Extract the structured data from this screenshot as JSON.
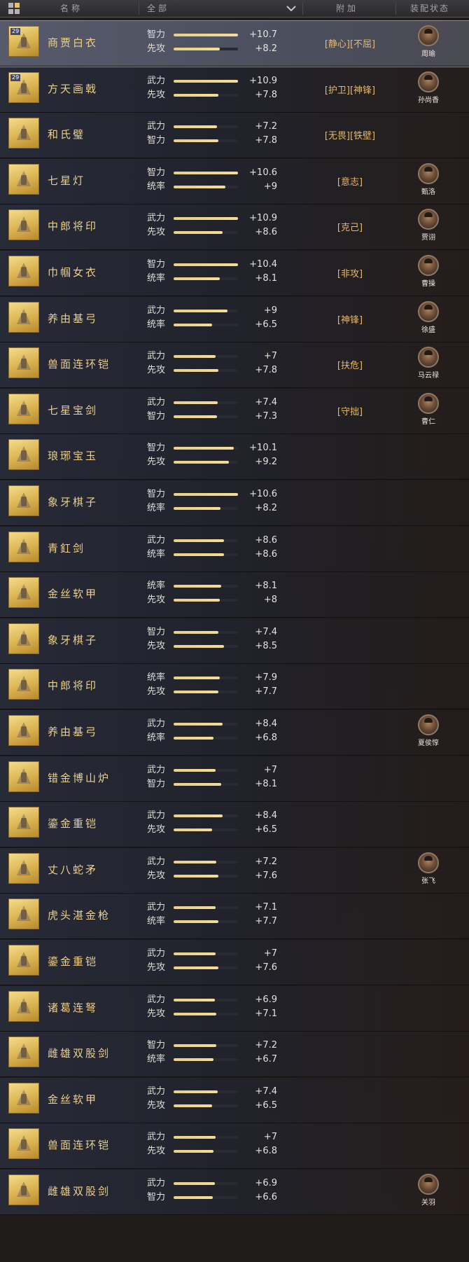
{
  "header": {
    "name_col": "名称",
    "filter_value": "全部",
    "extra_col": "附加",
    "equip_col": "装配状态"
  },
  "rows": [
    {
      "name": "商贾白衣",
      "icon": "white-robe-icon",
      "tag": "29",
      "selected": true,
      "stats": [
        {
          "label": "智力",
          "value": "+10.7",
          "pct": 1.0
        },
        {
          "label": "先攻",
          "value": "+8.2",
          "pct": 0.72
        }
      ],
      "extras": "[静心][不屈]",
      "equipped_by": "周瑜"
    },
    {
      "name": "方天画戟",
      "icon": "halberd-icon",
      "tag": "29",
      "stats": [
        {
          "label": "武力",
          "value": "+10.9",
          "pct": 1.0
        },
        {
          "label": "先攻",
          "value": "+7.8",
          "pct": 0.7
        }
      ],
      "extras": "[护卫][神锋]",
      "equipped_by": "孙尚香"
    },
    {
      "name": "和氏璧",
      "icon": "jade-disc-icon",
      "stats": [
        {
          "label": "武力",
          "value": "+7.2",
          "pct": 0.67
        },
        {
          "label": "智力",
          "value": "+7.8",
          "pct": 0.7
        }
      ],
      "extras": "[无畏][铁壁]",
      "equipped_by": ""
    },
    {
      "name": "七星灯",
      "icon": "seven-star-lamp-icon",
      "stats": [
        {
          "label": "智力",
          "value": "+10.6",
          "pct": 1.0
        },
        {
          "label": "统率",
          "value": "+9",
          "pct": 0.8
        }
      ],
      "extras": "[意志]",
      "equipped_by": "甄洛"
    },
    {
      "name": "中郎将印",
      "icon": "seal-box-icon",
      "stats": [
        {
          "label": "武力",
          "value": "+10.9",
          "pct": 1.0
        },
        {
          "label": "先攻",
          "value": "+8.6",
          "pct": 0.76
        }
      ],
      "extras": "[克己]",
      "equipped_by": "贾诩"
    },
    {
      "name": "巾帼女衣",
      "icon": "female-armor-icon",
      "stats": [
        {
          "label": "智力",
          "value": "+10.4",
          "pct": 1.0
        },
        {
          "label": "统率",
          "value": "+8.1",
          "pct": 0.72
        }
      ],
      "extras": "[非攻]",
      "equipped_by": "曹操"
    },
    {
      "name": "养由基弓",
      "icon": "bow-icon",
      "stats": [
        {
          "label": "武力",
          "value": "+9",
          "pct": 0.84
        },
        {
          "label": "统率",
          "value": "+6.5",
          "pct": 0.6
        }
      ],
      "extras": "[神锋]",
      "equipped_by": "徐盛"
    },
    {
      "name": "兽面连环铠",
      "icon": "chain-armor-icon",
      "stats": [
        {
          "label": "武力",
          "value": "+7",
          "pct": 0.65
        },
        {
          "label": "先攻",
          "value": "+7.8",
          "pct": 0.7
        }
      ],
      "extras": "[扶危]",
      "equipped_by": "马云禄"
    },
    {
      "name": "七星宝剑",
      "icon": "sword-icon",
      "stats": [
        {
          "label": "武力",
          "value": "+7.4",
          "pct": 0.68
        },
        {
          "label": "智力",
          "value": "+7.3",
          "pct": 0.67
        }
      ],
      "extras": "[守拙]",
      "equipped_by": "曹仁"
    },
    {
      "name": "琅琊宝玉",
      "icon": "jade-treasure-icon",
      "stats": [
        {
          "label": "智力",
          "value": "+10.1",
          "pct": 0.94
        },
        {
          "label": "先攻",
          "value": "+9.2",
          "pct": 0.86
        }
      ],
      "extras": "",
      "equipped_by": ""
    },
    {
      "name": "象牙棋子",
      "icon": "chess-board-icon",
      "stats": [
        {
          "label": "智力",
          "value": "+10.6",
          "pct": 1.0
        },
        {
          "label": "统率",
          "value": "+8.2",
          "pct": 0.73
        }
      ],
      "extras": "",
      "equipped_by": ""
    },
    {
      "name": "青釭剑",
      "icon": "sword-icon",
      "stats": [
        {
          "label": "武力",
          "value": "+8.6",
          "pct": 0.78
        },
        {
          "label": "统率",
          "value": "+8.6",
          "pct": 0.78
        }
      ],
      "extras": "",
      "equipped_by": ""
    },
    {
      "name": "金丝软甲",
      "icon": "golden-armor-icon",
      "stats": [
        {
          "label": "统率",
          "value": "+8.1",
          "pct": 0.74
        },
        {
          "label": "先攻",
          "value": "+8",
          "pct": 0.72
        }
      ],
      "extras": "",
      "equipped_by": ""
    },
    {
      "name": "象牙棋子",
      "icon": "chess-board-icon",
      "stats": [
        {
          "label": "智力",
          "value": "+7.4",
          "pct": 0.7
        },
        {
          "label": "先攻",
          "value": "+8.5",
          "pct": 0.78
        }
      ],
      "extras": "",
      "equipped_by": ""
    },
    {
      "name": "中郎将印",
      "icon": "seal-box-icon",
      "stats": [
        {
          "label": "统率",
          "value": "+7.9",
          "pct": 0.72
        },
        {
          "label": "先攻",
          "value": "+7.7",
          "pct": 0.7
        }
      ],
      "extras": "",
      "equipped_by": ""
    },
    {
      "name": "养由基弓",
      "icon": "bow-icon",
      "stats": [
        {
          "label": "武力",
          "value": "+8.4",
          "pct": 0.76
        },
        {
          "label": "统率",
          "value": "+6.8",
          "pct": 0.62
        }
      ],
      "extras": "",
      "equipped_by": "夏侯惇"
    },
    {
      "name": "错金博山炉",
      "icon": "incense-burner-icon",
      "stats": [
        {
          "label": "武力",
          "value": "+7",
          "pct": 0.65
        },
        {
          "label": "智力",
          "value": "+8.1",
          "pct": 0.74
        }
      ],
      "extras": "",
      "equipped_by": ""
    },
    {
      "name": "鎏金重铠",
      "icon": "heavy-armor-icon",
      "stats": [
        {
          "label": "武力",
          "value": "+8.4",
          "pct": 0.76
        },
        {
          "label": "先攻",
          "value": "+6.5",
          "pct": 0.6
        }
      ],
      "extras": "",
      "equipped_by": ""
    },
    {
      "name": "丈八蛇矛",
      "icon": "serpent-spear-icon",
      "stats": [
        {
          "label": "武力",
          "value": "+7.2",
          "pct": 0.66
        },
        {
          "label": "先攻",
          "value": "+7.6",
          "pct": 0.7
        }
      ],
      "extras": "",
      "equipped_by": "张飞"
    },
    {
      "name": "虎头湛金枪",
      "icon": "spear-icon",
      "stats": [
        {
          "label": "武力",
          "value": "+7.1",
          "pct": 0.65
        },
        {
          "label": "统率",
          "value": "+7.7",
          "pct": 0.7
        }
      ],
      "extras": "",
      "equipped_by": ""
    },
    {
      "name": "鎏金重铠",
      "icon": "heavy-armor-icon",
      "stats": [
        {
          "label": "武力",
          "value": "+7",
          "pct": 0.65
        },
        {
          "label": "先攻",
          "value": "+7.6",
          "pct": 0.7
        }
      ],
      "extras": "",
      "equipped_by": ""
    },
    {
      "name": "诸葛连弩",
      "icon": "crossbow-icon",
      "stats": [
        {
          "label": "武力",
          "value": "+6.9",
          "pct": 0.64
        },
        {
          "label": "先攻",
          "value": "+7.1",
          "pct": 0.66
        }
      ],
      "extras": "",
      "equipped_by": ""
    },
    {
      "name": "雌雄双股剑",
      "icon": "twin-swords-icon",
      "stats": [
        {
          "label": "智力",
          "value": "+7.2",
          "pct": 0.66
        },
        {
          "label": "统率",
          "value": "+6.7",
          "pct": 0.62
        }
      ],
      "extras": "",
      "equipped_by": ""
    },
    {
      "name": "金丝软甲",
      "icon": "golden-armor-icon",
      "stats": [
        {
          "label": "武力",
          "value": "+7.4",
          "pct": 0.68
        },
        {
          "label": "先攻",
          "value": "+6.5",
          "pct": 0.6
        }
      ],
      "extras": "",
      "equipped_by": ""
    },
    {
      "name": "兽面连环铠",
      "icon": "chain-armor-icon",
      "stats": [
        {
          "label": "武力",
          "value": "+7",
          "pct": 0.65
        },
        {
          "label": "先攻",
          "value": "+6.8",
          "pct": 0.62
        }
      ],
      "extras": "",
      "equipped_by": ""
    },
    {
      "name": "雌雄双股剑",
      "icon": "twin-swords-icon",
      "stats": [
        {
          "label": "武力",
          "value": "+6.9",
          "pct": 0.64
        },
        {
          "label": "智力",
          "value": "+6.6",
          "pct": 0.61
        }
      ],
      "extras": "",
      "equipped_by": "关羽"
    }
  ]
}
